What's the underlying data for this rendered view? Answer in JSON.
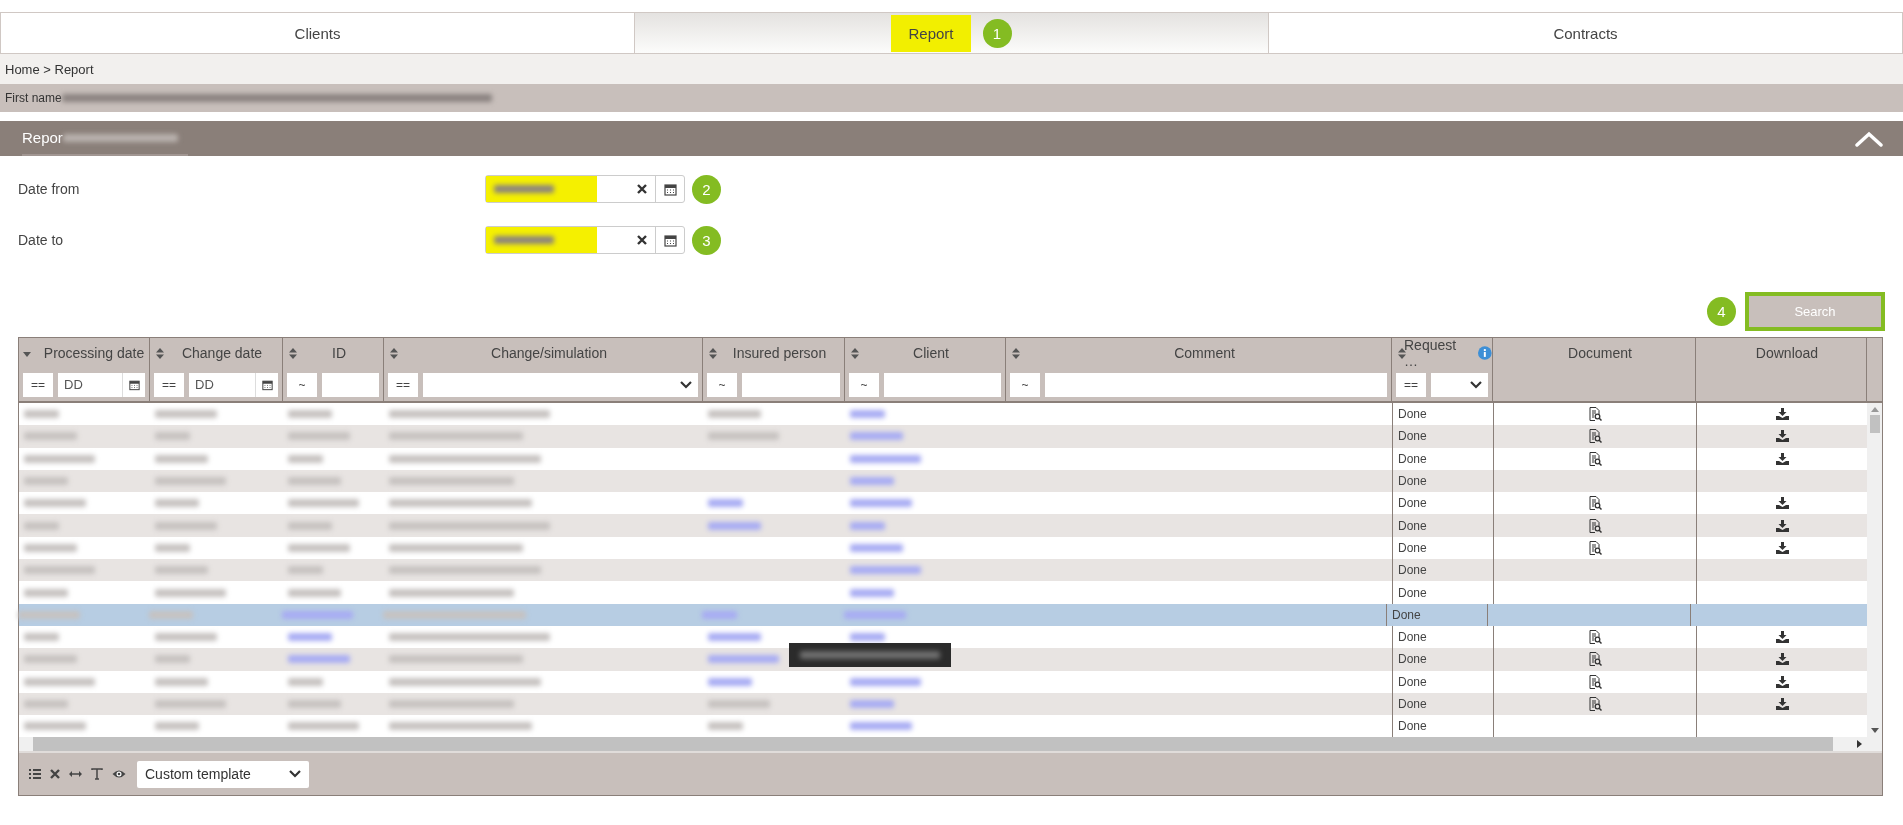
{
  "tabs": [
    {
      "label": "Clients",
      "selected": false,
      "highlighted": false
    },
    {
      "label": "Report",
      "selected": true,
      "highlighted": true,
      "badge": "1"
    },
    {
      "label": "Contracts",
      "selected": false,
      "highlighted": false
    }
  ],
  "breadcrumb": "Home > Report",
  "info_bar": {
    "label": "First name",
    "redacted": true
  },
  "section": {
    "title": "Repor",
    "redacted": true,
    "expanded": true
  },
  "form": [
    {
      "label": "Date from",
      "highlighted": true,
      "badge": "2"
    },
    {
      "label": "Date to",
      "highlighted": true,
      "badge": "3"
    }
  ],
  "search_button": {
    "label": "Search",
    "badge": "4"
  },
  "table": {
    "columns": [
      {
        "label": "Processing date",
        "sortable": true,
        "sorted_descending": true,
        "filter": {
          "operator": "==",
          "kind": "date",
          "placeholder": "DD"
        }
      },
      {
        "label": "Change date",
        "sortable": true,
        "sorted_descending": false,
        "filter": {
          "operator": "==",
          "kind": "date",
          "placeholder": "DD"
        }
      },
      {
        "label": "ID",
        "sortable": true,
        "sorted_descending": false,
        "filter": {
          "operator": "~",
          "kind": "text"
        }
      },
      {
        "label": "Change/simulation",
        "sortable": true,
        "sorted_descending": false,
        "filter": {
          "operator": "==",
          "kind": "select"
        }
      },
      {
        "label": "Insured person",
        "sortable": true,
        "sorted_descending": false,
        "filter": {
          "operator": "~",
          "kind": "text"
        }
      },
      {
        "label": "Client",
        "sortable": true,
        "sorted_descending": false,
        "filter": {
          "operator": "~",
          "kind": "text"
        }
      },
      {
        "label": "Comment",
        "sortable": true,
        "sorted_descending": false,
        "filter": {
          "operator": "~",
          "kind": "text"
        }
      },
      {
        "label": "Request …",
        "sortable": true,
        "sorted_descending": false,
        "info": true,
        "filter": {
          "operator": "==",
          "kind": "select"
        }
      },
      {
        "label": "Document",
        "sortable": false
      },
      {
        "label": "Download",
        "sortable": false
      }
    ],
    "rows": [
      {
        "selected": false,
        "cells": [
          {
            "kind": "text"
          },
          {
            "kind": "text"
          },
          {
            "kind": "text"
          },
          {
            "kind": "text"
          },
          {
            "kind": "text"
          },
          {
            "kind": "link"
          },
          {
            "kind": "empty"
          }
        ],
        "status": "Done",
        "document": true,
        "download": true
      },
      {
        "selected": false,
        "cells": [
          {
            "kind": "text"
          },
          {
            "kind": "text"
          },
          {
            "kind": "text"
          },
          {
            "kind": "text"
          },
          {
            "kind": "text"
          },
          {
            "kind": "link"
          },
          {
            "kind": "empty"
          }
        ],
        "status": "Done",
        "document": true,
        "download": true
      },
      {
        "selected": false,
        "cells": [
          {
            "kind": "text"
          },
          {
            "kind": "text"
          },
          {
            "kind": "text"
          },
          {
            "kind": "text"
          },
          {
            "kind": "empty"
          },
          {
            "kind": "link"
          },
          {
            "kind": "empty"
          }
        ],
        "status": "Done",
        "document": true,
        "download": true
      },
      {
        "selected": false,
        "cells": [
          {
            "kind": "text"
          },
          {
            "kind": "text"
          },
          {
            "kind": "text"
          },
          {
            "kind": "text"
          },
          {
            "kind": "empty"
          },
          {
            "kind": "link"
          },
          {
            "kind": "empty"
          }
        ],
        "status": "Done",
        "document": false,
        "download": false
      },
      {
        "selected": false,
        "cells": [
          {
            "kind": "text"
          },
          {
            "kind": "text"
          },
          {
            "kind": "text"
          },
          {
            "kind": "text"
          },
          {
            "kind": "link"
          },
          {
            "kind": "link"
          },
          {
            "kind": "empty"
          }
        ],
        "status": "Done",
        "document": true,
        "download": true
      },
      {
        "selected": false,
        "cells": [
          {
            "kind": "text"
          },
          {
            "kind": "text"
          },
          {
            "kind": "text"
          },
          {
            "kind": "text"
          },
          {
            "kind": "link"
          },
          {
            "kind": "link"
          },
          {
            "kind": "empty"
          }
        ],
        "status": "Done",
        "document": true,
        "download": true
      },
      {
        "selected": false,
        "cells": [
          {
            "kind": "text"
          },
          {
            "kind": "text"
          },
          {
            "kind": "text"
          },
          {
            "kind": "text"
          },
          {
            "kind": "empty"
          },
          {
            "kind": "link"
          },
          {
            "kind": "empty"
          }
        ],
        "status": "Done",
        "document": true,
        "download": true
      },
      {
        "selected": false,
        "cells": [
          {
            "kind": "text"
          },
          {
            "kind": "text"
          },
          {
            "kind": "text"
          },
          {
            "kind": "text"
          },
          {
            "kind": "empty"
          },
          {
            "kind": "link"
          },
          {
            "kind": "empty"
          }
        ],
        "status": "Done",
        "document": false,
        "download": false
      },
      {
        "selected": false,
        "cells": [
          {
            "kind": "text"
          },
          {
            "kind": "text"
          },
          {
            "kind": "text"
          },
          {
            "kind": "text"
          },
          {
            "kind": "empty"
          },
          {
            "kind": "link"
          },
          {
            "kind": "empty"
          }
        ],
        "status": "Done",
        "document": false,
        "download": false
      },
      {
        "selected": true,
        "cells": [
          {
            "kind": "text"
          },
          {
            "kind": "text"
          },
          {
            "kind": "link"
          },
          {
            "kind": "text"
          },
          {
            "kind": "link"
          },
          {
            "kind": "link"
          },
          {
            "kind": "empty"
          }
        ],
        "status": "Done",
        "document": false,
        "download": false
      },
      {
        "selected": false,
        "cells": [
          {
            "kind": "text"
          },
          {
            "kind": "text"
          },
          {
            "kind": "link"
          },
          {
            "kind": "text"
          },
          {
            "kind": "link"
          },
          {
            "kind": "link"
          },
          {
            "kind": "empty"
          }
        ],
        "status": "Done",
        "document": true,
        "download": true
      },
      {
        "selected": false,
        "cells": [
          {
            "kind": "text"
          },
          {
            "kind": "text"
          },
          {
            "kind": "link"
          },
          {
            "kind": "text"
          },
          {
            "kind": "link"
          },
          {
            "kind": "empty"
          },
          {
            "kind": "empty"
          }
        ],
        "status": "Done",
        "document": true,
        "download": true
      },
      {
        "selected": false,
        "cells": [
          {
            "kind": "text"
          },
          {
            "kind": "text"
          },
          {
            "kind": "text"
          },
          {
            "kind": "text"
          },
          {
            "kind": "link"
          },
          {
            "kind": "link"
          },
          {
            "kind": "empty"
          }
        ],
        "status": "Done",
        "document": true,
        "download": true
      },
      {
        "selected": false,
        "cells": [
          {
            "kind": "text"
          },
          {
            "kind": "text"
          },
          {
            "kind": "text"
          },
          {
            "kind": "text"
          },
          {
            "kind": "text"
          },
          {
            "kind": "link"
          },
          {
            "kind": "empty"
          }
        ],
        "status": "Done",
        "document": true,
        "download": true
      },
      {
        "selected": false,
        "cells": [
          {
            "kind": "text"
          },
          {
            "kind": "text"
          },
          {
            "kind": "text"
          },
          {
            "kind": "text"
          },
          {
            "kind": "text"
          },
          {
            "kind": "link"
          },
          {
            "kind": "empty"
          }
        ],
        "status": "Done",
        "document": false,
        "download": false
      }
    ]
  },
  "tooltip": {
    "redacted": true
  },
  "footer": {
    "template": "Custom template"
  }
}
